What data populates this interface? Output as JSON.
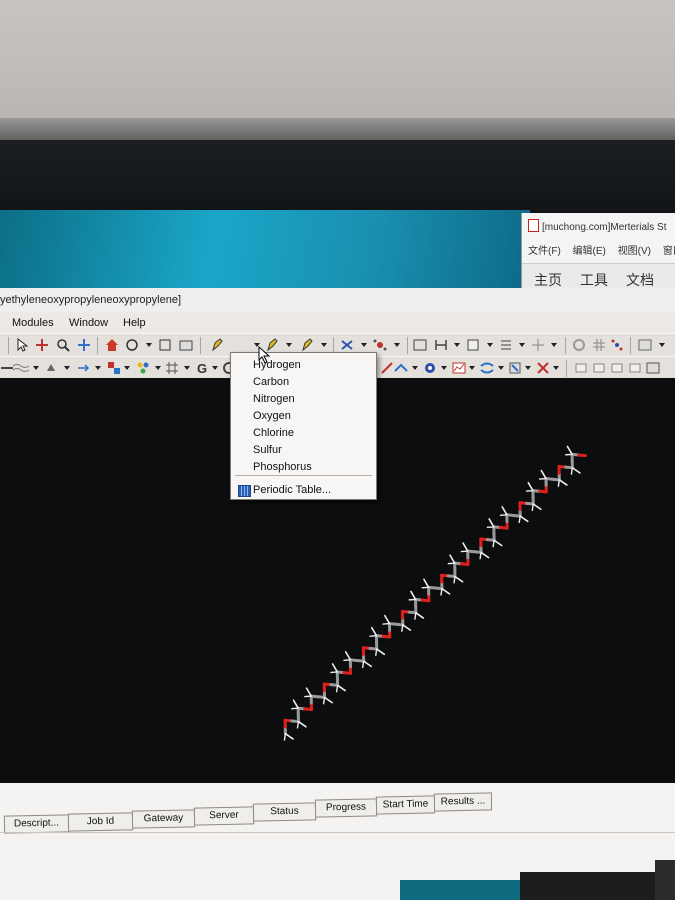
{
  "pdf_window": {
    "title": "[muchong.com]Merterials St",
    "menu": [
      "文件(F)",
      "编辑(E)",
      "视图(V)",
      "窗口"
    ],
    "tabs": [
      "主页",
      "工具",
      "文档"
    ]
  },
  "main_window": {
    "title": "yethyleneoxypropyleneoxypropylene]",
    "menu": [
      "Modules",
      "Window",
      "Help"
    ]
  },
  "toolbar": {
    "element_value": "C"
  },
  "element_dropdown": {
    "items": [
      "Hydrogen",
      "Carbon",
      "Nitrogen",
      "Oxygen",
      "Chlorine",
      "Sulfur",
      "Phosphorus"
    ],
    "periodic_table": "Periodic Table..."
  },
  "jobs_table": {
    "columns": [
      "Descript...",
      "Job Id",
      "Gateway",
      "Server",
      "Status",
      "Progress",
      "Start Time",
      "Results ..."
    ]
  },
  "colors": {
    "viewer_bg": "#0b0d0f",
    "oxygen": "#e0201a",
    "carbon": "#9a9a9a",
    "hydrogen": "#eeeeee"
  }
}
